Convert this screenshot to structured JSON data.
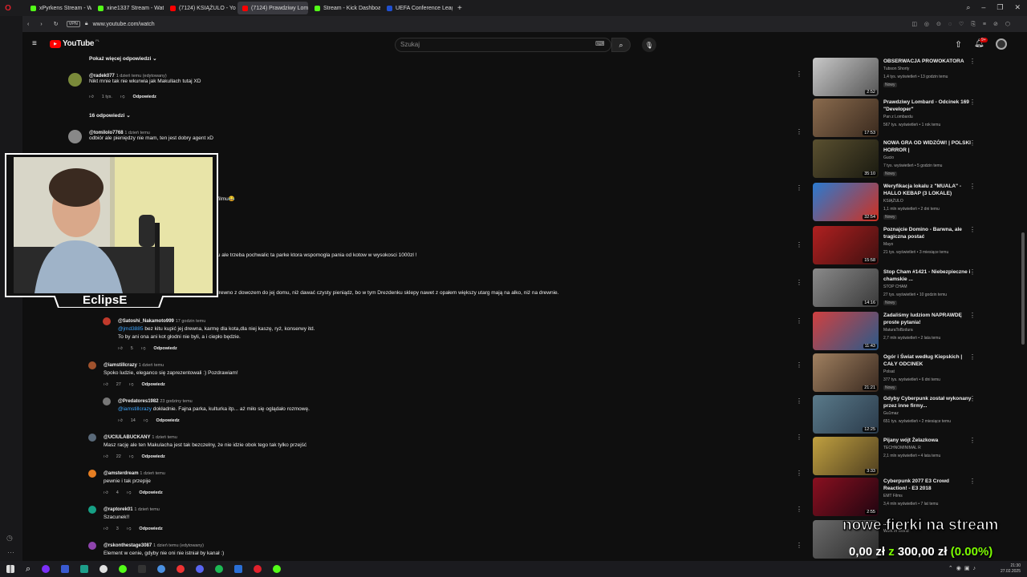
{
  "browser": {
    "tabs": [
      {
        "label": "xPyrkens Stream - Watch",
        "color": "#53fc18"
      },
      {
        "label": "xine1337 Stream - Watch",
        "color": "#53fc18"
      },
      {
        "label": "(7124) KSIĄŻULO - YouTu",
        "color": "#ff0000"
      },
      {
        "label": "(7124) Prawdziwy Lomba",
        "color": "#ff0000",
        "active": true
      },
      {
        "label": "Stream - Kick Dashboard",
        "color": "#53fc18"
      },
      {
        "label": "UEFA Conference League",
        "color": "#2050d0"
      }
    ],
    "vpn_label": "VPN",
    "url": "www.youtube.com/watch"
  },
  "youtube": {
    "logo": "YouTube",
    "logo_sup": "PL",
    "search_placeholder": "Szukaj",
    "notif_count": "9+"
  },
  "comments": {
    "show_more_replies": "Pokaż więcej odpowiedzi",
    "items": [
      {
        "author": "@radek077",
        "time": "1 dzień temu (edytowany)",
        "text": "Nikt mnie tak nie wkurwia jak Makullach tutaj XD",
        "likes": "1 tys.",
        "reply": "Odpowiedz",
        "av": "#7a8a3a"
      },
      {
        "author": "@tomilolo7768",
        "time": "1 dzień temu",
        "text": "odbiór ale pieniędzy nie mam, ten jest dobry agent xD",
        "av": "#888"
      }
    ],
    "replies_toggle": "16 odpowiedzi",
    "partial": [
      "y filmu😂",
      "chu ale trzeba pochwalic ta parke ktora wspomogla pania od kotow w wysokosci 1000zl !",
      "ć drewno z dowozem do jej domu, niż dawać czysty pieniądz, bo w tym Drezdenku sklepy nawet z opałem większy utarg mają na alko, niż na drewnie."
    ],
    "thread": [
      {
        "author": "@Satoshi_Nakamoto999",
        "time": "17 godzin temu",
        "mention": "@jmd3885",
        "text": " bez kitu kupić jej drewna, karmę dla kota,dla niej kaszę, ryż, konserwy itd.",
        "text2": "To by ani ona ani kot głodni nie byli, a i ciepło będzie.",
        "likes": "5",
        "reply": "Odpowiedz",
        "av": "#c0392b"
      },
      {
        "author": "@iamstillcrazy",
        "time": "1 dzień temu",
        "text": "Spoko ludzie, eleganco się zaprezentowali :) Pozdrawiam!",
        "likes": "27",
        "reply": "Odpowiedz",
        "av": "#a0522d"
      },
      {
        "author": "@Predatores1982",
        "time": "23 godziny temu",
        "mention": "@iamstillcrazy",
        "text": " dokładnie. Fajna parka, kulturka itp... aż miło się oglądało rozmowę.",
        "likes": "14",
        "reply": "Odpowiedz",
        "av": "#777"
      },
      {
        "author": "@UCIULABUCKANY",
        "time": "1 dzień temu",
        "text": "Masz rację ale ten Makulacha jest tak bezczelny, że nie idzie obok tego tak tylko przejść",
        "likes": "22",
        "reply": "Odpowiedz",
        "av": "#5a6a7a"
      },
      {
        "author": "@amsterdream",
        "time": "1 dzień temu",
        "text": "pewnie i tak przepije",
        "likes": "4",
        "reply": "Odpowiedz",
        "av": "#e67e22"
      },
      {
        "author": "@raptorek01",
        "time": "1 dzień temu",
        "text": "Szacunek!!",
        "likes": "3",
        "reply": "Odpowiedz",
        "av": "#16a085"
      },
      {
        "author": "@rskonthestage3087",
        "time": "1 dzień temu (edytowany)",
        "text": "Element w cenie, gdyby nie oni nie istniał by kanał :)",
        "av": "#8e44ad"
      }
    ]
  },
  "webcam": {
    "name": "EclipsE"
  },
  "recommendations": [
    {
      "title": "OBSERWACJA PROWOKATORA",
      "channel": "Tubson Shorty",
      "meta": "1,4 tys. wyświetleń • 13 godzin temu",
      "new": "Nowy",
      "dur": "2:52",
      "c1": "#c8c8c8",
      "c2": "#555"
    },
    {
      "title": "Prawdziwy Lombard - Odcinek 169 \"Developer\"",
      "channel": "Pan z Lombardu",
      "meta": "567 tys. wyświetleń • 1 rok temu",
      "dur": "17:53",
      "c1": "#8a6b4e",
      "c2": "#3a2a1e"
    },
    {
      "title": "NOWA GRA OD WIDZÓW! | POLSKI HORROR |",
      "channel": "Gucio",
      "meta": "7 tys. wyświetleń • 5 godzin temu",
      "new": "Nowy",
      "dur": "35:10",
      "c1": "#5a5030",
      "c2": "#1a1a10"
    },
    {
      "title": "Weryfikacja lokalu z \"MUALA\" - HALLO KEBAP (3 LOKALE)",
      "channel": "KSIĄŻULO",
      "meta": "1,1 mln wyświetleń • 2 dni temu",
      "new": "Nowy",
      "dur": "32:54",
      "c1": "#2a7ad0",
      "c2": "#d03020"
    },
    {
      "title": "Poznajcie Domino - Barwna, ale tragiczna postać",
      "channel": "Mayo",
      "meta": "21 tys. wyświetleń • 3 miesiące temu",
      "dur": "15:58",
      "c1": "#b02020",
      "c2": "#401010"
    },
    {
      "title": "Stop Cham #1421 - Niebezpieczne i chamskie ...",
      "channel": "STOP CHAM",
      "meta": "27 tys. wyświetleń • 10 godzin temu",
      "new": "Nowy",
      "dur": "14:16",
      "c1": "#8a8a8a",
      "c2": "#3a3a3a"
    },
    {
      "title": "Zadaliśmy ludziom NAPRAWDĘ proste pytania!",
      "channel": "MaturaToBzdura",
      "meta": "2,7 mln wyświetleń • 2 lata temu",
      "dur": "11:43",
      "c1": "#d04040",
      "c2": "#2a5a8a"
    },
    {
      "title": "Ogór i Świat według Kiepskich | CAŁY ODCINEK",
      "channel": "Polsat",
      "meta": "377 tys. wyświetleń • 6 dni temu",
      "new": "Nowy",
      "dur": "21:21",
      "c1": "#a08060",
      "c2": "#3a2a20"
    },
    {
      "title": "Gdyby Cyberpunk został wykonany przez inne firmy...",
      "channel": "Gu1maz",
      "meta": "651 tys. wyświetleń • 2 miesiące temu",
      "dur": "12:25",
      "c1": "#5a7a8a",
      "c2": "#2a3a4a"
    },
    {
      "title": "Pijany wójt Żelazkowa",
      "channel": "TECHNOMINIMAL R",
      "meta": "2,1 mln wyświetleń • 4 lata temu",
      "dur": "3:33",
      "c1": "#c0a040",
      "c2": "#504020"
    },
    {
      "title": "Cyberpunk 2077 E3 Crowd Reaction! - E3 2018",
      "channel": "EMT Films",
      "meta": "3,4 mln wyświetleń • 7 lat temu",
      "dur": "2:55",
      "c1": "#8a1020",
      "c2": "#200510"
    },
    {
      "title": "...",
      "channel": "Work In World",
      "meta": "",
      "dur": "",
      "c1": "#6a6a6a",
      "c2": "#2a2a2a"
    }
  ],
  "overlay": {
    "line1": "nowe fierki na stream",
    "amount": "0,00 zł",
    "sep": "z",
    "goal": "300,00 zł",
    "pct": "(0.00%)"
  },
  "clock": {
    "time": "21:30",
    "date": "27.02.2025"
  }
}
